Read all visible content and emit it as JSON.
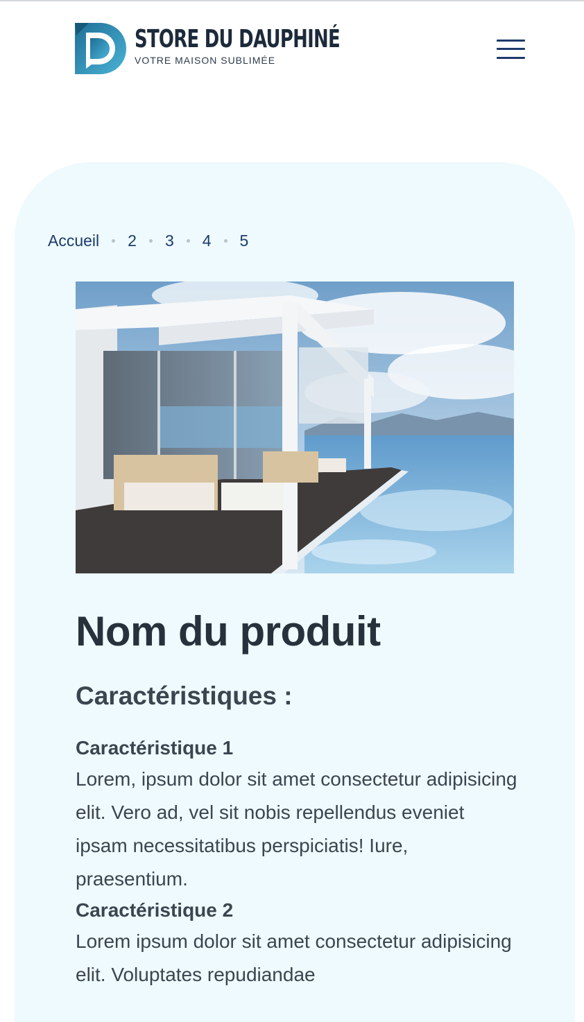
{
  "header": {
    "brand_name": "STORE DU DAUPHINÉ",
    "brand_tagline": "VOTRE MAISON SUBLIMÉE",
    "menu_icon": "hamburger-menu-icon"
  },
  "breadcrumb": {
    "home": "Accueil",
    "items": [
      "2",
      "3",
      "4",
      "5"
    ]
  },
  "product": {
    "title": "Nom du produit",
    "subtitle": "Caractéristiques :",
    "features": [
      {
        "title": "Caractéristique 1",
        "text": "Lorem, ipsum dolor sit amet consectetur adipisicing elit. Vero ad, vel sit nobis repellendus eveniet ipsam necessitatibus perspiciatis! Iure, praesentium."
      },
      {
        "title": "Caractéristique 2",
        "text": "Lorem ipsum dolor sit amet consectetur adipisicing elit. Voluptates repudiandae"
      }
    ]
  },
  "colors": {
    "brand_navy": "#1e3a6b",
    "panel_bg": "#eefafd",
    "logo_blue": "#2f8fb5",
    "text_dark": "#27313c"
  }
}
